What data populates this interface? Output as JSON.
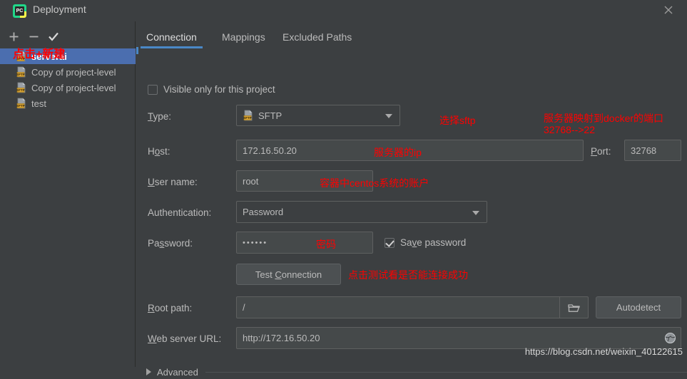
{
  "window": {
    "title": "Deployment",
    "logo_text": "PC",
    "close_label": "✕"
  },
  "sidebar": {
    "toolbar": [
      {
        "name": "add",
        "glyph": "+",
        "tooltip": "Add"
      },
      {
        "name": "remove",
        "glyph": "−",
        "tooltip": "Remove"
      },
      {
        "name": "apply",
        "glyph": "✓",
        "tooltip": "Use as default"
      }
    ],
    "annotation": "点击+新建",
    "items": [
      {
        "label": "serverai",
        "type": "SFTP",
        "selected": true
      },
      {
        "label": "Copy of project-level",
        "type": "SFTP",
        "selected": false
      },
      {
        "label": "Copy of project-level",
        "type": "SFTP",
        "selected": false
      },
      {
        "label": "test",
        "type": "SFTP",
        "selected": false
      }
    ]
  },
  "main": {
    "tabs": [
      {
        "label": "Connection",
        "active": true
      },
      {
        "label": "Mappings",
        "active": false
      },
      {
        "label": "Excluded Paths",
        "active": false
      }
    ],
    "visible_only": {
      "label": "Visible only for this project",
      "checked": false
    },
    "type": {
      "label": "Type:",
      "mnemonic": "T",
      "value": "SFTP",
      "icon": "sftp-icon",
      "annotation": "选择sftp"
    },
    "host": {
      "label": "Host:",
      "mnemonic": "o",
      "value": "172.16.50.20",
      "annotation": "服务器的ip"
    },
    "port": {
      "label": "Port:",
      "mnemonic": "P",
      "value": "32768",
      "annotation_line1": "服务器映射到docker的端口",
      "annotation_line2": "32768-->22"
    },
    "username": {
      "label": "User name:",
      "mnemonic": "U",
      "value": "root",
      "annotation": "容器中centos系统的账户"
    },
    "authentication": {
      "label": "Authentication:",
      "value": "Password"
    },
    "password": {
      "label": "Password:",
      "mnemonic": "s",
      "value": "••••••",
      "annotation": "密码",
      "save_password": {
        "label": "Save password",
        "checked": true
      }
    },
    "test_connection": {
      "label": "Test Connection",
      "mnemonic": "C",
      "annotation": "点击测试看是否能连接成功"
    },
    "root_path": {
      "label": "Root path:",
      "mnemonic": "R",
      "value": "/",
      "browse_icon": "folder-icon",
      "autodetect_label": "Autodetect"
    },
    "web_server_url": {
      "label": "Web server URL:",
      "mnemonic": "W",
      "value": "http://172.16.50.20",
      "open_icon": "globe-icon"
    },
    "advanced": {
      "label": "Advanced",
      "expanded": false
    }
  },
  "watermark": "https://blog.csdn.net/weixin_40122615",
  "colors": {
    "background": "#3c3f41",
    "selection": "#4b6eaf",
    "accent": "#4a88c7",
    "annotation": "#ff0000",
    "field_bg": "#45494a",
    "border": "#5e6060"
  }
}
